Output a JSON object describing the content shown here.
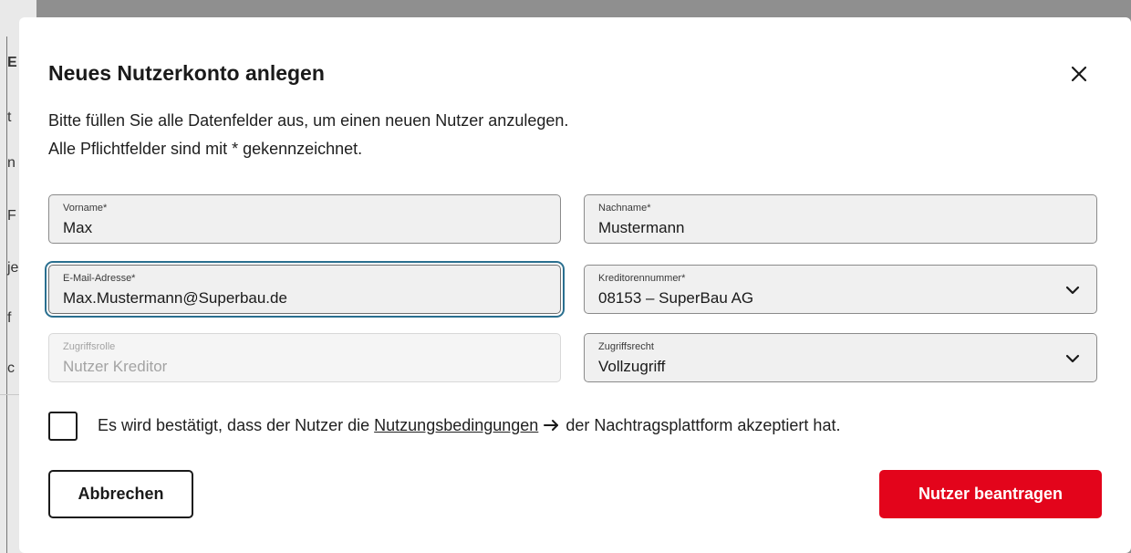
{
  "background": {
    "fragments": [
      "E",
      "t",
      "n",
      "F",
      "je",
      "f",
      "c"
    ]
  },
  "dialog": {
    "title": "Neues Nutzerkonto anlegen",
    "close_icon": "close-icon",
    "description_line1": "Bitte füllen Sie alle Datenfelder aus, um einen neuen Nutzer anzulegen.",
    "description_line2": "Alle Pflichtfelder sind mit * gekennzeichnet."
  },
  "fields": {
    "vorname": {
      "label": "Vorname*",
      "value": "Max"
    },
    "nachname": {
      "label": "Nachname*",
      "value": "Mustermann"
    },
    "email": {
      "label": "E-Mail-Adresse*",
      "value": "Max.Mustermann@Superbau.de"
    },
    "kreditorennummer": {
      "label": "Kreditorennummer*",
      "value": "08153 – SuperBau AG",
      "icon": "chevron-down-icon"
    },
    "zugriffsrolle": {
      "label": "Zugriffsrolle",
      "value": "Nutzer Kreditor",
      "disabled": true
    },
    "zugriffsrecht": {
      "label": "Zugriffsrecht",
      "value": "Vollzugriff",
      "icon": "chevron-down-icon"
    }
  },
  "consent": {
    "checked": false,
    "text_before": "Es wird bestätigt, dass der Nutzer die",
    "link_text": "Nutzungsbedingungen",
    "text_after": "der Nachtragsplattform akzeptiert hat."
  },
  "buttons": {
    "cancel_label": "Abbrechen",
    "submit_label": "Nutzer beantragen"
  },
  "colors": {
    "accent_red": "#e3041b",
    "focus_ring": "#2a6f8f",
    "field_bg": "#f0f0f0"
  }
}
